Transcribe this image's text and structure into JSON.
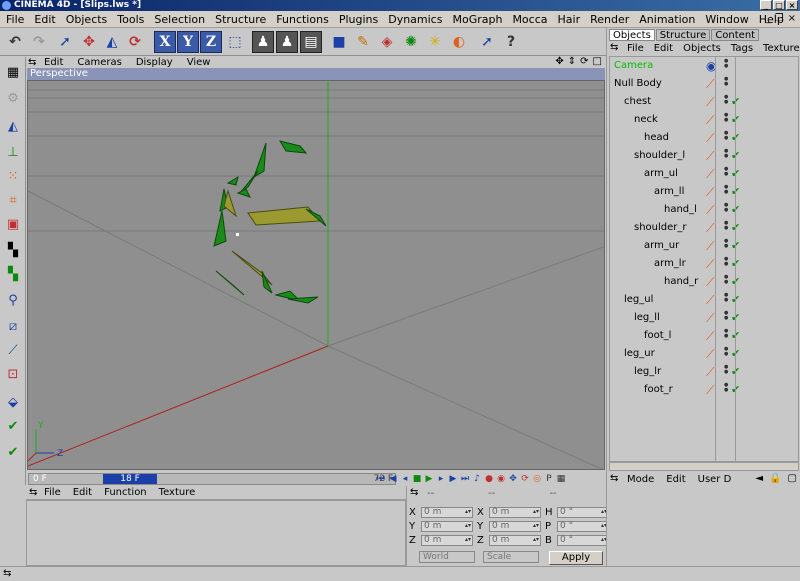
{
  "window": {
    "title": "CINEMA 4D - [Slips.lws *]"
  },
  "menubar": [
    "File",
    "Edit",
    "Objects",
    "Tools",
    "Selection",
    "Structure",
    "Functions",
    "Plugins",
    "Dynamics",
    "MoGraph",
    "Mocca",
    "Hair",
    "Render",
    "Animation",
    "Window",
    "Help"
  ],
  "toolbar": {
    "axis_x": "X",
    "axis_y": "Y",
    "axis_z": "Z"
  },
  "viewport": {
    "menu": [
      "Edit",
      "Cameras",
      "Display",
      "View"
    ],
    "label": "Perspective",
    "axis_y": "Y",
    "axis_z": "Z"
  },
  "timeline": {
    "start": "0 F",
    "current": "18 F",
    "end": "72 F"
  },
  "bottom_panel": {
    "menu": [
      "File",
      "Edit",
      "Function",
      "Texture"
    ]
  },
  "coordinates": {
    "headers": [
      "--",
      "--",
      "--"
    ],
    "rows": [
      {
        "l1": "X",
        "v1": "0 m",
        "l2": "X",
        "v2": "0 m",
        "l3": "H",
        "v3": "0 °"
      },
      {
        "l1": "Y",
        "v1": "0 m",
        "l2": "Y",
        "v2": "0 m",
        "l3": "P",
        "v3": "0 °"
      },
      {
        "l1": "Z",
        "v1": "0 m",
        "l2": "Z",
        "v2": "0 m",
        "l3": "B",
        "v3": "0 °"
      }
    ],
    "mode_world": "World",
    "mode_scale": "Scale",
    "apply": "Apply"
  },
  "object_manager": {
    "tabs": [
      "Objects",
      "Structure",
      "Content"
    ],
    "menu": [
      "File",
      "Edit",
      "Objects",
      "Tags",
      "Texture"
    ],
    "objects": [
      {
        "name": "Camera",
        "depth": 0,
        "color": "#00c000"
      },
      {
        "name": "Null Body",
        "depth": 0
      },
      {
        "name": "chest",
        "depth": 1
      },
      {
        "name": "neck",
        "depth": 2
      },
      {
        "name": "head",
        "depth": 3
      },
      {
        "name": "shoulder_l",
        "depth": 2
      },
      {
        "name": "arm_ul",
        "depth": 3
      },
      {
        "name": "arm_ll",
        "depth": 4
      },
      {
        "name": "hand_l",
        "depth": 5
      },
      {
        "name": "shoulder_r",
        "depth": 2
      },
      {
        "name": "arm_ur",
        "depth": 3
      },
      {
        "name": "arm_lr",
        "depth": 4
      },
      {
        "name": "hand_r",
        "depth": 5
      },
      {
        "name": "leg_ul",
        "depth": 1
      },
      {
        "name": "leg_ll",
        "depth": 2
      },
      {
        "name": "foot_l",
        "depth": 3
      },
      {
        "name": "leg_ur",
        "depth": 1
      },
      {
        "name": "leg_lr",
        "depth": 2
      },
      {
        "name": "foot_r",
        "depth": 3
      }
    ]
  },
  "attribute_manager": {
    "menu": [
      "Mode",
      "Edit",
      "User D"
    ]
  },
  "colors": {
    "viewport_bg": "#8f8f8f",
    "bone_green": "#1a8a1a",
    "bone_yellow": "#9a9a30",
    "selected_blue": "#1a3fa6"
  }
}
